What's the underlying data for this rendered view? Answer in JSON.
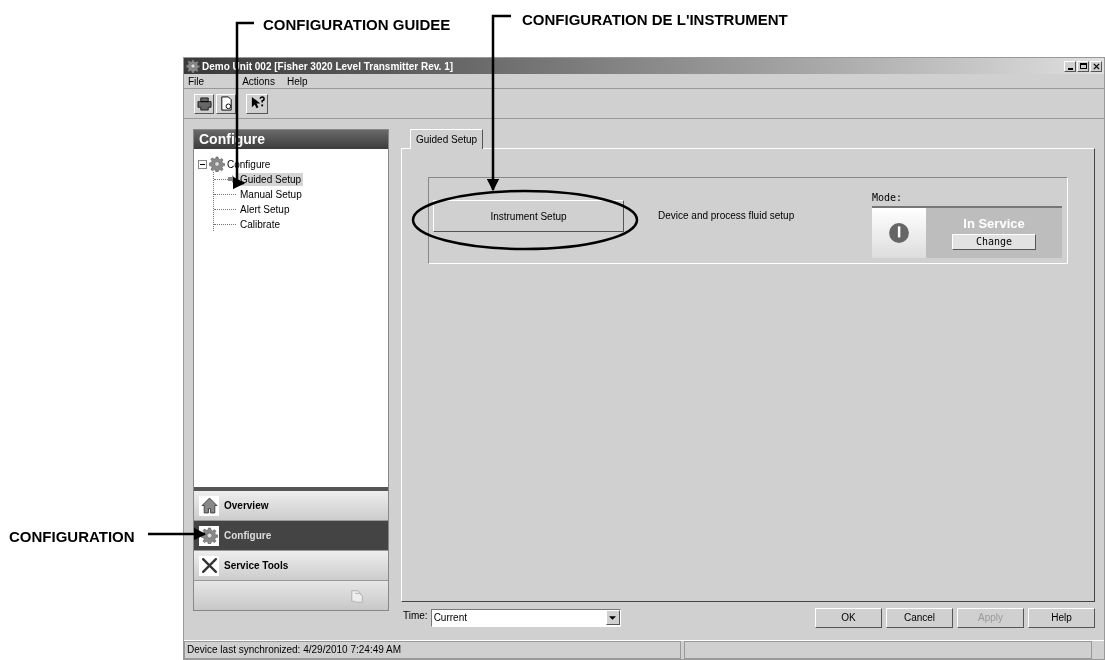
{
  "callouts": [
    {
      "label": "CONFIGURATION GUIDEE"
    },
    {
      "label": "CONFIGURATION DE L'INSTRUMENT"
    },
    {
      "label": "CONFIGURATION"
    }
  ],
  "window": {
    "title": "Demo Unit 002 [Fisher 3020 Level Transmitter Rev. 1]"
  },
  "menu": [
    "File",
    "Actions",
    "Help"
  ],
  "sidebar": {
    "title": "Configure",
    "tree": {
      "label": "Configure",
      "expanded": true,
      "children": [
        {
          "label": "Guided Setup",
          "selected": true
        },
        {
          "label": "Manual Setup",
          "selected": false
        },
        {
          "label": "Alert Setup",
          "selected": false
        },
        {
          "label": "Calibrate",
          "selected": false
        }
      ]
    },
    "nav": [
      {
        "label": "Overview",
        "kind": "home",
        "selected": false
      },
      {
        "label": "Configure",
        "kind": "gear",
        "selected": true
      },
      {
        "label": "Service Tools",
        "kind": "tools",
        "selected": false
      }
    ]
  },
  "tabs": [
    {
      "label": "Guided Setup",
      "selected": true
    }
  ],
  "guided": {
    "button": "Instrument Setup",
    "description": "Device and process fluid setup",
    "mode": {
      "label": "Mode:",
      "value": "In Service",
      "button": "Change"
    }
  },
  "time": {
    "label": "Time:",
    "value": "Current"
  },
  "buttons": [
    {
      "label": "OK",
      "disabled": false
    },
    {
      "label": "Cancel",
      "disabled": false
    },
    {
      "label": "Apply",
      "disabled": true
    },
    {
      "label": "Help",
      "disabled": false
    }
  ],
  "status_bar": "Device last synchronized: 4/29/2010 7:24:49 AM"
}
